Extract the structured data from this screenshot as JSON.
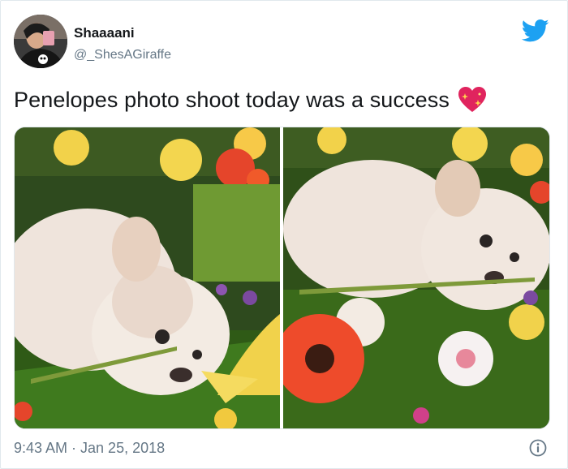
{
  "user": {
    "display_name": "Shaaaani",
    "handle": "@_ShesAGiraffe"
  },
  "tweet": {
    "text": "Penelopes photo shoot today was a success",
    "emoji": "sparkling-heart-icon"
  },
  "media": {
    "count": 2
  },
  "meta": {
    "timestamp": "9:43 AM · Jan 25, 2018"
  },
  "icons": {
    "brand": "twitter-bird-icon",
    "info": "info-icon"
  },
  "colors": {
    "twitter_blue": "#1da1f2",
    "text": "#14171a",
    "secondary": "#657786",
    "heart": "#e0245e"
  }
}
